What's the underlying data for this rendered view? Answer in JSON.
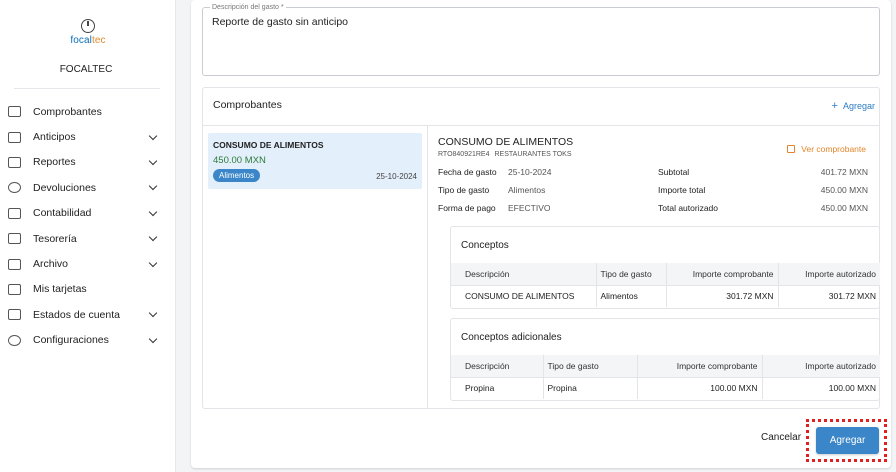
{
  "logo": {
    "prefix": "focal",
    "accent": "tec"
  },
  "company": "FOCALTEC",
  "sidebar": {
    "items": [
      {
        "label": "Comprobantes",
        "icon": "receipt-icon",
        "expandable": false
      },
      {
        "label": "Anticipos",
        "icon": "cash-icon",
        "expandable": true
      },
      {
        "label": "Reportes",
        "icon": "report-icon",
        "expandable": true
      },
      {
        "label": "Devoluciones",
        "icon": "refund-icon",
        "expandable": true
      },
      {
        "label": "Contabilidad",
        "icon": "bank-icon",
        "expandable": true
      },
      {
        "label": "Tesorería",
        "icon": "piggy-bank-icon",
        "expandable": true
      },
      {
        "label": "Archivo",
        "icon": "archive-icon",
        "expandable": true
      },
      {
        "label": "Mis tarjetas",
        "icon": "card-icon",
        "expandable": false
      },
      {
        "label": "Estados de cuenta",
        "icon": "statement-icon",
        "expandable": true
      },
      {
        "label": "Configuraciones",
        "icon": "gear-icon",
        "expandable": true
      }
    ]
  },
  "description": {
    "label": "Descripción del gasto *",
    "value": "Reporte de gasto sin anticipo"
  },
  "comprobantes": {
    "title": "Comprobantes",
    "add_label": "Agregar",
    "list": [
      {
        "name": "CONSUMO DE ALIMENTOS",
        "amount": "450.00 MXN",
        "badge": "Alimentos",
        "date": "25-10-2024"
      }
    ]
  },
  "detail": {
    "name": "CONSUMO DE ALIMENTOS",
    "rfc": "RTO840921RE4",
    "vendor": "RESTAURANTES TOKS",
    "view_label": "Ver comprobante",
    "fields": [
      {
        "label": "Fecha de gasto",
        "value": "25-10-2024"
      },
      {
        "label": "Tipo de gasto",
        "value": "Alimentos"
      },
      {
        "label": "Forma de pago",
        "value": "EFECTIVO"
      }
    ],
    "totals": [
      {
        "label": "Subtotal",
        "value": "401.72 MXN"
      },
      {
        "label": "Importe total",
        "value": "450.00 MXN"
      },
      {
        "label": "Total autorizado",
        "value": "450.00 MXN"
      }
    ]
  },
  "conceptos": {
    "title": "Conceptos",
    "headers": [
      "Descripción",
      "Tipo de gasto",
      "Importe comprobante",
      "Importe autorizado"
    ],
    "rows": [
      [
        "CONSUMO DE ALIMENTOS",
        "Alimentos",
        "301.72 MXN",
        "301.72 MXN"
      ]
    ]
  },
  "conceptos_adicionales": {
    "title": "Conceptos adicionales",
    "headers": [
      "Descripción",
      "Tipo de gasto",
      "Importe comprobante",
      "Importe autorizado"
    ],
    "rows": [
      [
        "Propina",
        "Propina",
        "100.00 MXN",
        "100.00 MXN"
      ]
    ]
  },
  "actions": {
    "cancel": "Cancelar",
    "submit": "Agregar"
  },
  "colors": {
    "primary": "#3a86c8",
    "link": "#2d7ec4",
    "orange": "#e0862a",
    "amount_green": "#2c7a3a",
    "highlight_dotted": "#e02020"
  }
}
